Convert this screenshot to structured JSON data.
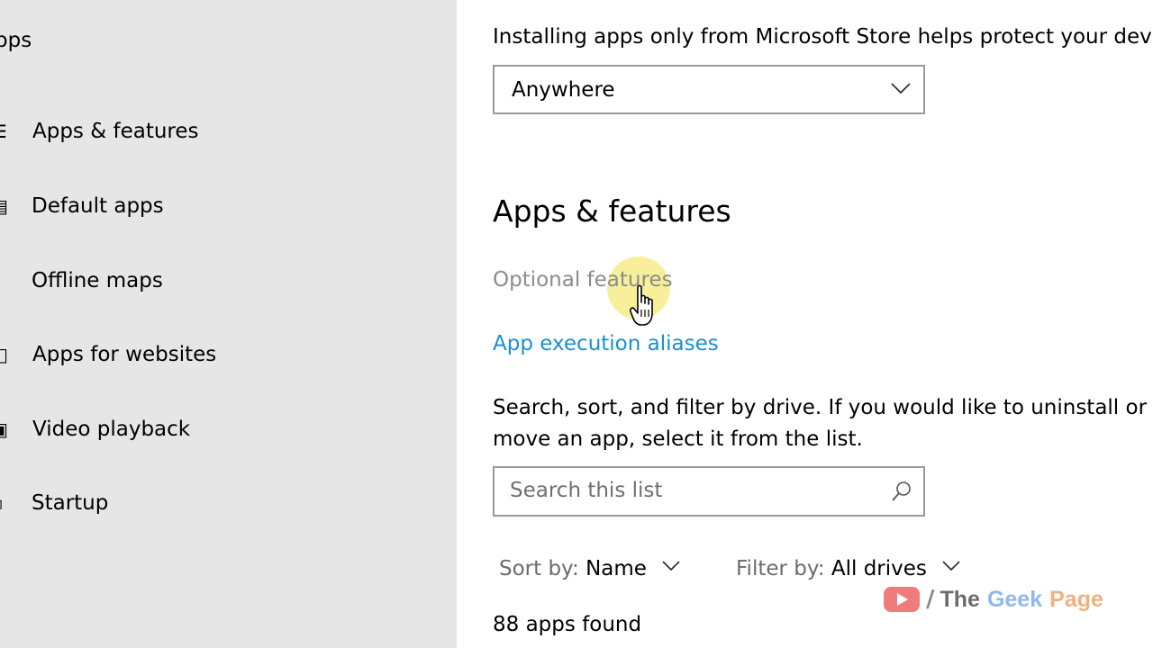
{
  "sidebar": {
    "title": "pps",
    "items": [
      {
        "label": "Apps & features",
        "icon": "list-icon",
        "glyph": "☰"
      },
      {
        "label": "Default apps",
        "icon": "default-apps-icon",
        "glyph": "▤"
      },
      {
        "label": "Offline maps",
        "icon": "download-map-icon",
        "glyph": "⤓"
      },
      {
        "label": "Apps for websites",
        "icon": "web-apps-icon",
        "glyph": "□"
      },
      {
        "label": "Video playback",
        "icon": "video-icon",
        "glyph": "▣"
      },
      {
        "label": "Startup",
        "icon": "startup-icon",
        "glyph": "▫"
      }
    ]
  },
  "main": {
    "intro_text": "Installing apps only from Microsoft Store helps protect your dev",
    "install_source": {
      "selected": "Anywhere"
    },
    "section_heading": "Apps & features",
    "optional_features_link": "Optional features",
    "app_execution_aliases_link": "App execution aliases",
    "description": "Search, sort, and filter by drive. If you would like to uninstall or move an app, select it from the list.",
    "search": {
      "placeholder": "Search this list",
      "value": ""
    },
    "sort": {
      "label": "Sort by:",
      "value": "Name"
    },
    "filter": {
      "label": "Filter by:",
      "value": "All drives"
    },
    "apps_found": "88 apps found"
  },
  "watermark": {
    "the": "The",
    "geek": "Geek",
    "page": "Page",
    "slash": "/"
  },
  "colors": {
    "sidebar_bg": "#e6e6e6",
    "link_blue": "#1a8fd0",
    "disabled_gray": "#8c8c8c",
    "border_gray": "#9a9a9a",
    "cursor_highlight": "#f6ea78"
  }
}
